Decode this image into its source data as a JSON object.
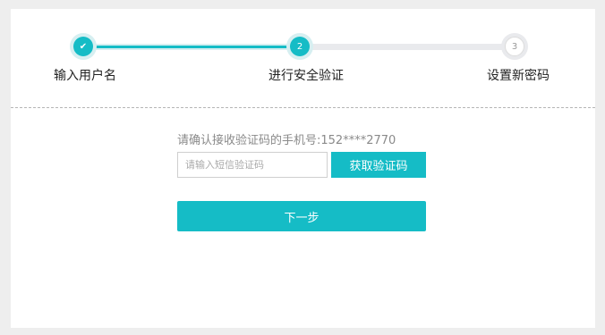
{
  "steps": [
    {
      "label": "输入用户名",
      "marker": "✔",
      "state": "done"
    },
    {
      "label": "进行安全验证",
      "marker": "2",
      "state": "active"
    },
    {
      "label": "设置新密码",
      "marker": "3",
      "state": "todo"
    }
  ],
  "form": {
    "phone_prompt": "请确认接收验证码的手机号:152****2770",
    "code_placeholder": "请输入短信验证码",
    "code_value": "",
    "get_code_label": "获取验证码",
    "next_label": "下一步"
  },
  "colors": {
    "accent": "#15bcc6",
    "track_inactive": "#e9eaed"
  }
}
